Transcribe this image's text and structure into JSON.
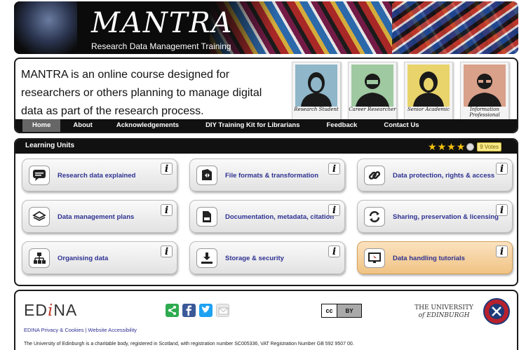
{
  "banner": {
    "title": "MANTRA",
    "subtitle": "Research Data Management Training"
  },
  "intro": {
    "text": "MANTRA is an online course designed for researchers or others planning to manage digital data as part of the research process."
  },
  "personas": [
    {
      "label": "Research Student",
      "icon": "female-student-avatar"
    },
    {
      "label": "Career Researcher",
      "icon": "bearded-man-avatar"
    },
    {
      "label": "Senior Academic",
      "icon": "woman-avatar"
    },
    {
      "label": "Information Professional",
      "icon": "man-with-glasses-avatar"
    }
  ],
  "nav": [
    "Home",
    "About",
    "Acknowledgements",
    "DIY Training Kit for Librarians",
    "Feedback",
    "Contact Us"
  ],
  "units": {
    "header": "Learning Units",
    "rating": {
      "filled_stars": 4,
      "max_stars": 5,
      "votes_label": "9 Votes"
    },
    "info_glyph": "i",
    "items": [
      {
        "label": "Research data explained",
        "icon": "speech-bubble-icon"
      },
      {
        "label": "File formats & transformation",
        "icon": "file-transform-icon"
      },
      {
        "label": "Data protection, rights & access",
        "icon": "chain-link-icon"
      },
      {
        "label": "Data management plans",
        "icon": "layers-icon"
      },
      {
        "label": "Documentation, metadata, citation",
        "icon": "document-folder-icon"
      },
      {
        "label": "Sharing, preservation & licensing",
        "icon": "refresh-arrows-icon"
      },
      {
        "label": "Organising data",
        "icon": "hierarchy-icon"
      },
      {
        "label": "Storage & security",
        "icon": "download-tray-icon"
      },
      {
        "label": "Data handling tutorials",
        "icon": "screen-cursor-icon"
      }
    ]
  },
  "footer": {
    "edina_prefix": "ED",
    "edina_i": "i",
    "edina_suffix": "NA",
    "uoe_line1": "THE UNIVERSITY",
    "uoe_line2": "of EDINBURGH",
    "cc_label": "cc",
    "cc_by": "BY",
    "links": "EDINA Privacy & Cookies | Website Accessibility",
    "charity": "The University of Edinburgh is a charitable body, registered in Scotland, with registration number SC005336, VAT Registration Number GB 592 9507 00."
  },
  "colors": {
    "link_blue": "#2e3192",
    "highlight_card": "#f0c384",
    "share_green": "#2eab4f",
    "facebook_blue": "#3b5998",
    "twitter_blue": "#1da1f2"
  }
}
